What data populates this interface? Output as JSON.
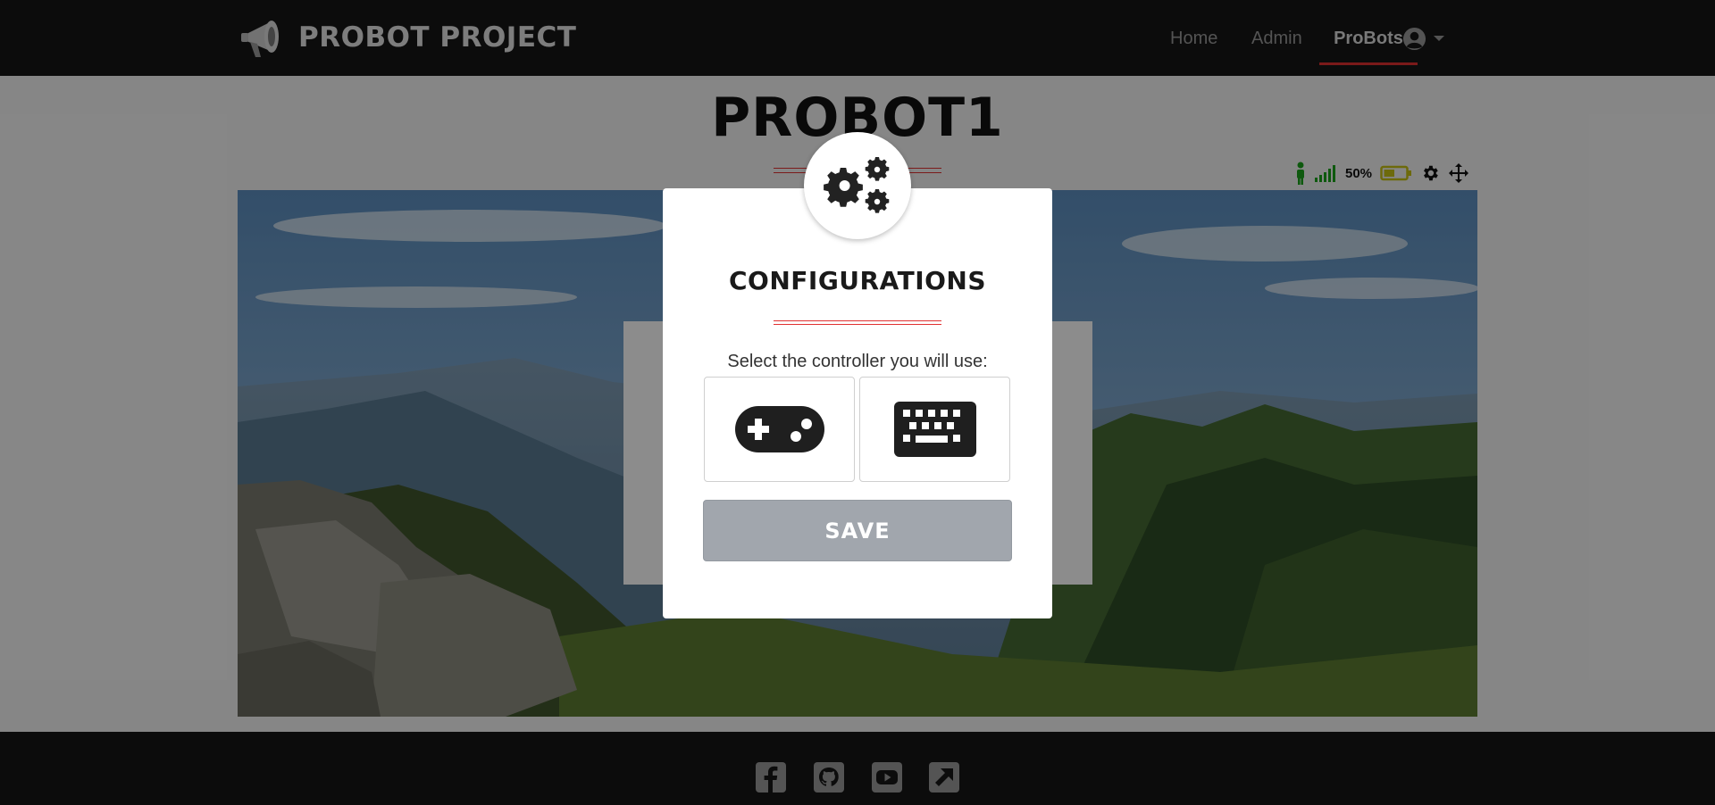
{
  "navbar": {
    "brand": "PROBOT PROJECT",
    "links": {
      "home": "Home",
      "admin": "Admin",
      "probots": "ProBots"
    },
    "active_link": "ProBots",
    "user_icon": "user-circle-icon"
  },
  "robot": {
    "name": "PROBOT1",
    "battery_percent_text": "50%",
    "battery_level": 0.5,
    "status_icons": [
      "person-icon",
      "signal-icon",
      "battery-icon",
      "gear-icon",
      "move-icon"
    ]
  },
  "modal": {
    "icon": "gears-icon",
    "title": "CONFIGURATIONS",
    "prompt": "Select the controller you will use:",
    "options": [
      {
        "id": "gamepad",
        "icon": "gamepad-icon"
      },
      {
        "id": "keyboard",
        "icon": "keyboard-icon"
      }
    ],
    "save_label": "SAVE"
  },
  "footer": {
    "social_icons": [
      "facebook-icon",
      "github-icon",
      "youtube-icon",
      "external-link-icon"
    ]
  },
  "colors": {
    "navbar_bg": "#161616",
    "accent_red": "#e03131",
    "save_button_bg": "#a1a6ad",
    "person_icon": "#1aa31a",
    "signal_icon": "#1aa31a",
    "battery_icon": "#c7c214"
  }
}
